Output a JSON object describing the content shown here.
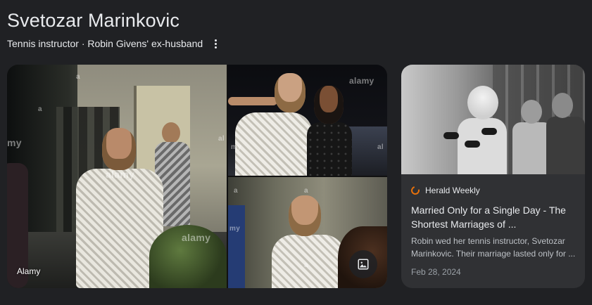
{
  "entity": {
    "title": "Svetozar Marinkovic",
    "subtitle": "Tennis instructor · Robin Givens' ex-husband"
  },
  "gallery": {
    "source_label": "Alamy",
    "watermark": "alamy",
    "watermark_short": "a",
    "watermark_partial": "my",
    "watermark_partial2": "al",
    "image_button_icon": "image-icon"
  },
  "article": {
    "source": "Herald Weekly",
    "title": "Married Only for a Single Day - The Shortest Marriages of ...",
    "snippet": "Robin wed her tennis instructor, Svetozar Marinkovic. Their marriage lasted only for ...",
    "date": "Feb 28, 2024",
    "source_icon_color": "#e8710a"
  },
  "colors": {
    "background": "#202124",
    "card": "#303134",
    "text": "#e8eaed",
    "muted": "#9aa0a6"
  }
}
